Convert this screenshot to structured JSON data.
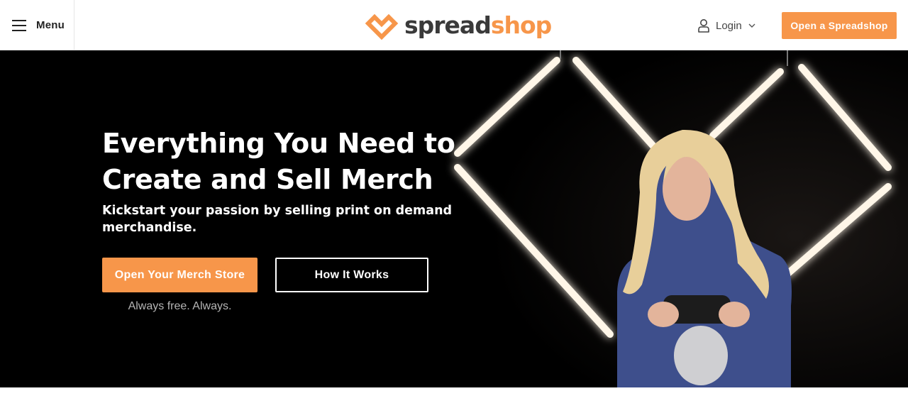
{
  "header": {
    "menu_label": "Menu",
    "logo": {
      "text_prefix": "spread",
      "text_suffix": "shop"
    },
    "login_label": "Login",
    "cta_label": "Open a Spreadshop"
  },
  "hero": {
    "title": "Everything You Need to Create and Sell Merch",
    "subtitle": "Kickstart your passion by selling print on demand merchandise.",
    "primary_button": "Open Your Merch Store",
    "secondary_button": "How It Works",
    "note": "Always free. Always."
  },
  "icons": [
    "hamburger-icon",
    "spreadshop-heart-logo-icon",
    "user-icon",
    "chevron-down-icon"
  ],
  "colors": {
    "accent": "#f7964a",
    "logo_dark": "#3a3a3a",
    "hero_bg": "#000000",
    "text_white": "#ffffff",
    "note_gray": "#b5b5b5"
  }
}
